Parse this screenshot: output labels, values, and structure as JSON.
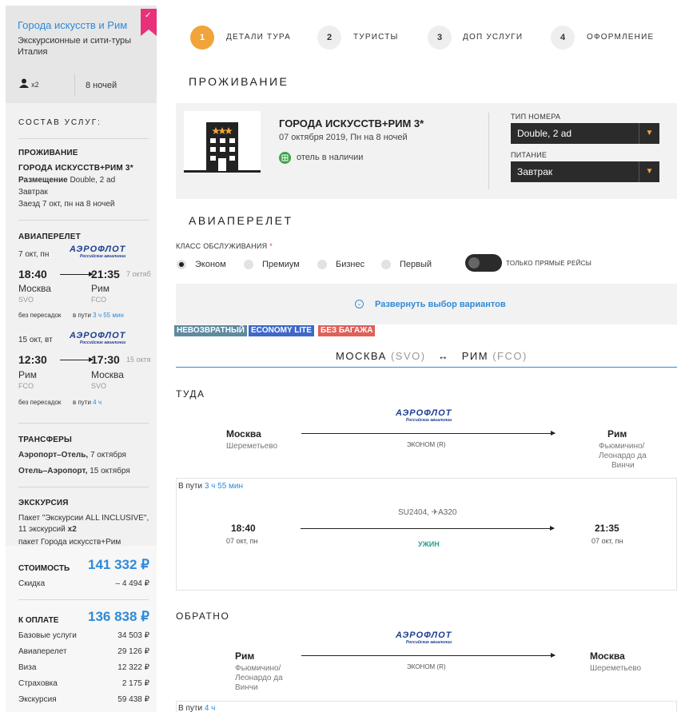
{
  "sidebar": {
    "tour_title": "Города искусств и Рим",
    "tour_type": "Экскурсионные и сити-туры",
    "country": "Италия",
    "persons": "x2",
    "nights": "8 ночей",
    "section_title": "СОСТАВ УСЛУГ:",
    "accommodation": {
      "heading": "ПРОЖИВАНИЕ",
      "hotel": "ГОРОДА ИСКУССТВ+РИМ 3*",
      "placement_label": "Размещение",
      "placement_value": "Double, 2 ad",
      "meal": "Завтрак",
      "checkin": "Заезд 7 окт, пн на 8 ночей"
    },
    "flight": {
      "heading": "АВИАПЕРЕЛЕТ",
      "airline_logo": "АЭРОФЛОТ",
      "airline_logo_sub": "Российские авиалинии",
      "outbound": {
        "date": "7 окт, пн",
        "dep_time": "18:40",
        "arr_time": "21:35",
        "arr_date": "7 октяб",
        "dep_city": "Москва",
        "arr_city": "Рим",
        "dep_code": "SVO",
        "arr_code": "FCO",
        "stops": "без пересадок",
        "in_way_label": "в пути",
        "duration": "3 ч 55 мин"
      },
      "return": {
        "date": "15 окт, вт",
        "dep_time": "12:30",
        "arr_time": "17:30",
        "arr_date": "15 октя",
        "dep_city": "Рим",
        "arr_city": "Москва",
        "dep_code": "FCO",
        "arr_code": "SVO",
        "stops": "без пересадок",
        "in_way_label": "в пути",
        "duration": "4 ч"
      }
    },
    "transfers": {
      "heading": "ТРАНСФЕРЫ",
      "t1_route": "Аэропорт–Отель,",
      "t1_date": "7 октября",
      "t2_route": "Отель–Аэропорт,",
      "t2_date": "15 октября"
    },
    "excursion": {
      "heading": "ЭКСКУРСИЯ",
      "line1": "Пакет \"Экскурсии ALL INCLUSIVE\",",
      "line2": "11 экскурсий",
      "line2_mult": "x2",
      "line3": "пакет Города искусств+Рим"
    },
    "totals": {
      "cost_label": "СТОИМОСТЬ",
      "cost_value": "141 332 ₽",
      "discount_label": "Скидка",
      "discount_value": "– 4 494 ₽",
      "pay_label": "К ОПЛАТЕ",
      "pay_value": "136 838 ₽",
      "rows": [
        {
          "label": "Базовые услуги",
          "value": "34 503 ₽"
        },
        {
          "label": "Авиаперелет",
          "value": "29 126 ₽"
        },
        {
          "label": "Виза",
          "value": "12 322 ₽"
        },
        {
          "label": "Страховка",
          "value": "2 175 ₽"
        },
        {
          "label": "Экскурсия",
          "value": "59 438 ₽"
        }
      ]
    }
  },
  "steps": [
    {
      "num": "1",
      "label": "ДЕТАЛИ ТУРА",
      "active": true
    },
    {
      "num": "2",
      "label": "ТУРИСТЫ",
      "active": false
    },
    {
      "num": "3",
      "label": "ДОП УСЛУГИ",
      "active": false
    },
    {
      "num": "4",
      "label": "ОФОРМЛЕНИЕ",
      "active": false
    }
  ],
  "accommodation": {
    "heading": "ПРОЖИВАНИЕ",
    "hotel_name": "ГОРОДА ИСКУССТВ+РИМ 3*",
    "dates": "07 октября 2019, Пн на 8 ночей",
    "availability": "отель в наличии",
    "room_type_label": "ТИП НОМЕРА",
    "room_type_value": "Double, 2 ad",
    "meal_label": "ПИТАНИЕ",
    "meal_value": "Завтрак"
  },
  "flight": {
    "heading": "АВИАПЕРЕЛЕТ",
    "class_label": "КЛАСС ОБСЛУЖИВАНИЯ",
    "required_mark": "*",
    "classes": [
      "Эконом",
      "Премиум",
      "Бизнес",
      "Первый"
    ],
    "selected_class": "Эконом",
    "direct_only_label": "ТОЛЬКО ПРЯМЫЕ РЕЙСЫ",
    "expand_label": "Развернуть выбор вариантов",
    "badges": [
      {
        "text": "НЕВОЗВРАТНЫЙ",
        "color": "#5f8aa0"
      },
      {
        "text": "ECONOMY LITE",
        "color": "#3f68c9"
      },
      {
        "text": "БЕЗ БАГАЖА",
        "color": "#e0605a"
      }
    ],
    "route_from": "МОСКВА",
    "route_from_code": "(SVO)",
    "route_to": "РИМ",
    "route_to_code": "(FCO)",
    "route_arrow": "↔",
    "there": {
      "heading": "ТУДА",
      "airline_logo": "АЭРОФЛОТ",
      "from_city": "Москва",
      "from_airport": "Шереметьево",
      "to_city": "Рим",
      "to_airport_1": "Фьюмичино/",
      "to_airport_2": "Леонардо да",
      "to_airport_3": "Винчи",
      "class": "ЭКОНОМ (R)",
      "in_way_label": "В пути",
      "duration": "3 ч 55 мин",
      "flight_no": "SU2404,",
      "aircraft": "A320",
      "dep_time": "18:40",
      "dep_date": "07 окт, пн",
      "arr_time": "21:35",
      "arr_date": "07 окт, пн",
      "meal": "УЖИН"
    },
    "back": {
      "heading": "ОБРАТНО",
      "airline_logo": "АЭРОФЛОТ",
      "from_city": "Рим",
      "from_airport_1": "Фьюмичино/",
      "from_airport_2": "Леонардо да",
      "from_airport_3": "Винчи",
      "to_city": "Москва",
      "to_airport": "Шереметьево",
      "class": "ЭКОНОМ (R)",
      "in_way_label": "В пути",
      "duration": "4 ч"
    }
  },
  "colors": {
    "accent": "#f0a43a",
    "link": "#2f8ad8",
    "ribbon": "#e8317a",
    "dark": "#2b2b2b",
    "meal": "#2a9d8f"
  }
}
